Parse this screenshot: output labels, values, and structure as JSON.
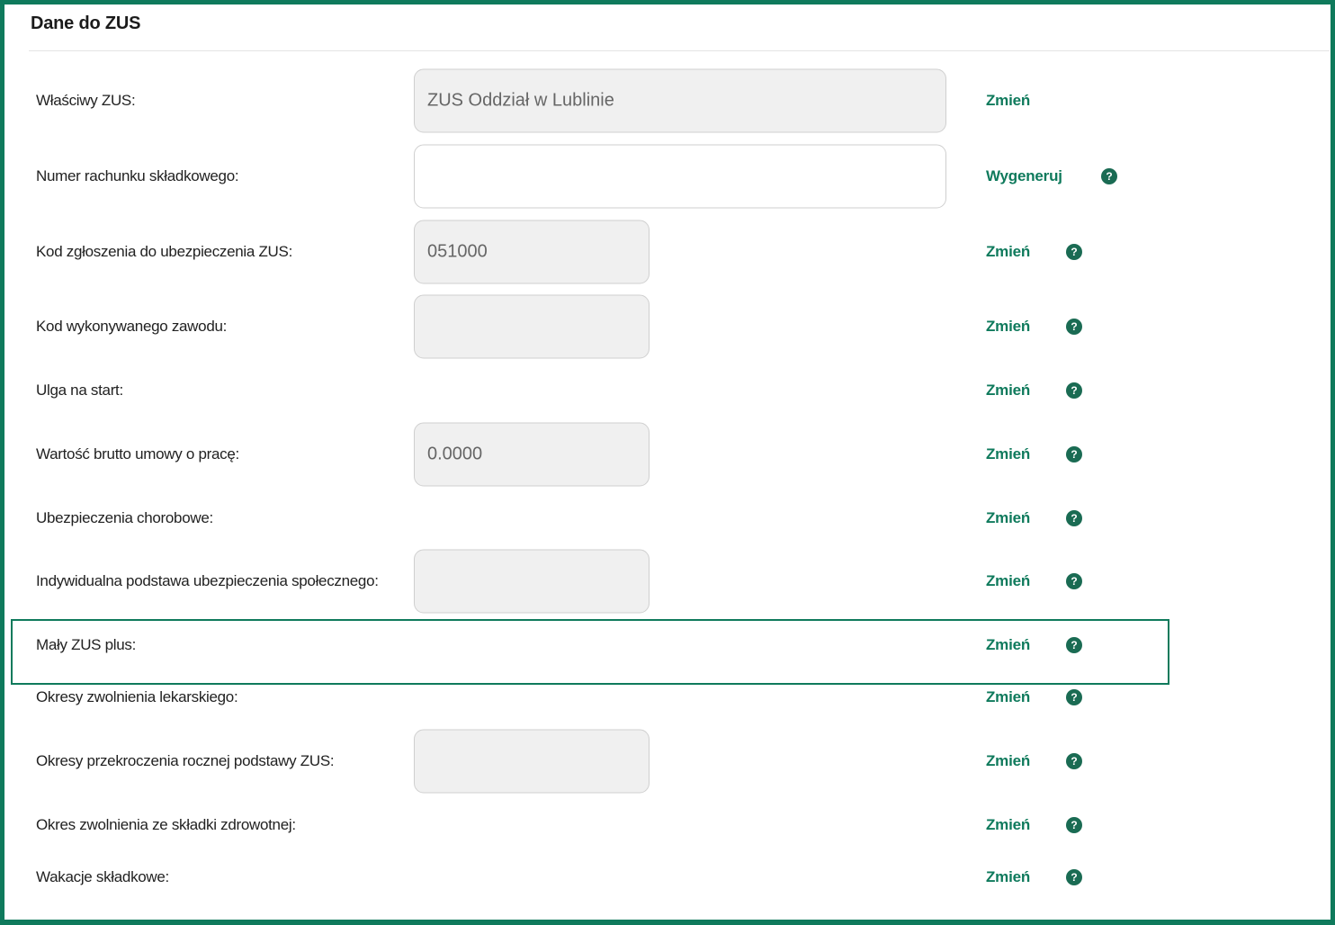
{
  "section": {
    "title": "Dane do ZUS"
  },
  "icons": {
    "help": "question-circle-icon",
    "help_glyph": "?"
  },
  "colors": {
    "accent": "#0f7a5c",
    "frame": "#0f7a5c"
  },
  "rows": [
    {
      "label": "Właściwy ZUS:",
      "value": "ZUS Oddział w Lublinie",
      "action": "Zmień"
    },
    {
      "label": "Numer rachunku składkowego:",
      "value": "",
      "action": "Wygeneruj"
    },
    {
      "label": "Kod zgłoszenia do ubezpieczenia ZUS:",
      "value": "051000",
      "action": "Zmień"
    },
    {
      "label": "Kod wykonywanego zawodu:",
      "value": "",
      "action": "Zmień"
    },
    {
      "label": "Ulga na start:",
      "action": "Zmień"
    },
    {
      "label": "Wartość brutto umowy o pracę:",
      "value": "0.0000",
      "action": "Zmień"
    },
    {
      "label": "Ubezpieczenia chorobowe:",
      "action": "Zmień"
    },
    {
      "label": "Indywidualna podstawa ubezpieczenia społecznego:",
      "value": "",
      "action": "Zmień"
    },
    {
      "label": "Mały ZUS plus:",
      "action": "Zmień"
    },
    {
      "label": "Okresy zwolnienia lekarskiego:",
      "action": "Zmień"
    },
    {
      "label": "Okresy przekroczenia rocznej podstawy ZUS:",
      "value": "",
      "action": "Zmień"
    },
    {
      "label": "Okres zwolnienia ze składki zdrowotnej:",
      "action": "Zmień"
    },
    {
      "label": "Wakacje składkowe:",
      "action": "Zmień"
    }
  ]
}
